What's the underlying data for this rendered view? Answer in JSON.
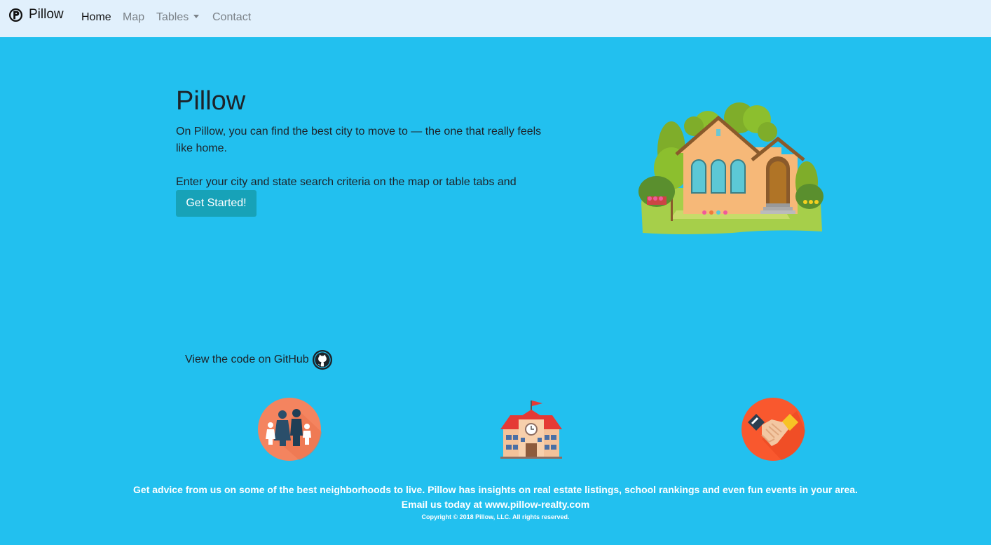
{
  "brand": {
    "name": "Pillow",
    "logo_icon": "pillow-logo-icon"
  },
  "nav": {
    "home": "Home",
    "map": "Map",
    "tables": "Tables",
    "contact": "Contact"
  },
  "hero": {
    "title": "Pillow",
    "description": "On Pillow, you can find the best city to move to — the one that really feels like home.",
    "cta_text": "Enter your city and state search criteria on the map or table tabs and",
    "button_label": "Get Started!",
    "illustration_icon": "house-illustration"
  },
  "github": {
    "label": "View the code on GitHub",
    "icon": "github-icon"
  },
  "features": [
    {
      "icon": "family-icon"
    },
    {
      "icon": "school-icon"
    },
    {
      "icon": "handshake-icon"
    }
  ],
  "footer": {
    "advice": "Get advice from us on some of the best neighborhoods to live. Pillow has insights on real estate listings, school rankings and even fun events in your area.",
    "email": "Email us today at www.pillow-realty.com",
    "copyright": "Copyright © 2018 Pillow, LLC. All rights reserved."
  },
  "colors": {
    "background": "#22c0ef",
    "navbar": "#e1f0fc",
    "button": "#17a2b8",
    "family_circle": "#f4845f",
    "handshake_circle": "#f9582e"
  }
}
